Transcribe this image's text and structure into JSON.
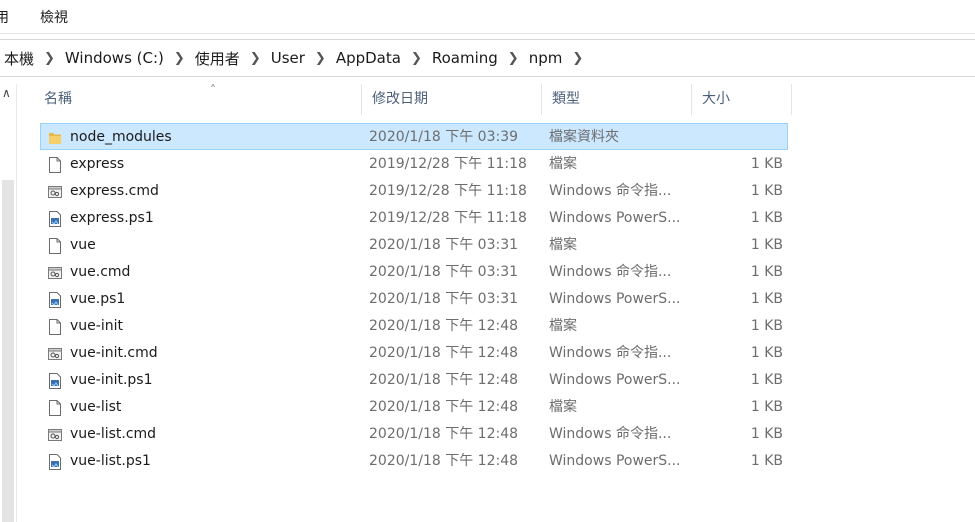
{
  "ribbon": {
    "tab_left": "用",
    "tab_view": "檢視"
  },
  "breadcrumb": [
    "本機",
    "Windows (C:)",
    "使用者",
    "User",
    "AppData",
    "Roaming",
    "npm"
  ],
  "columns": {
    "name": "名稱",
    "date": "修改日期",
    "type": "類型",
    "size": "大小"
  },
  "files": [
    {
      "name": "node_modules",
      "date": "2020/1/18 下午 03:39",
      "type": "檔案資料夾",
      "size": "",
      "icon": "folder-icon",
      "selected": true
    },
    {
      "name": "express",
      "date": "2019/12/28 下午 11:18",
      "type": "檔案",
      "size": "1 KB",
      "icon": "file-icon"
    },
    {
      "name": "express.cmd",
      "date": "2019/12/28 下午 11:18",
      "type": "Windows 命令指...",
      "size": "1 KB",
      "icon": "cmd-file-icon"
    },
    {
      "name": "express.ps1",
      "date": "2019/12/28 下午 11:18",
      "type": "Windows PowerS...",
      "size": "1 KB",
      "icon": "powershell-file-icon"
    },
    {
      "name": "vue",
      "date": "2020/1/18 下午 03:31",
      "type": "檔案",
      "size": "1 KB",
      "icon": "file-icon"
    },
    {
      "name": "vue.cmd",
      "date": "2020/1/18 下午 03:31",
      "type": "Windows 命令指...",
      "size": "1 KB",
      "icon": "cmd-file-icon"
    },
    {
      "name": "vue.ps1",
      "date": "2020/1/18 下午 03:31",
      "type": "Windows PowerS...",
      "size": "1 KB",
      "icon": "powershell-file-icon"
    },
    {
      "name": "vue-init",
      "date": "2020/1/18 下午 12:48",
      "type": "檔案",
      "size": "1 KB",
      "icon": "file-icon"
    },
    {
      "name": "vue-init.cmd",
      "date": "2020/1/18 下午 12:48",
      "type": "Windows 命令指...",
      "size": "1 KB",
      "icon": "cmd-file-icon"
    },
    {
      "name": "vue-init.ps1",
      "date": "2020/1/18 下午 12:48",
      "type": "Windows PowerS...",
      "size": "1 KB",
      "icon": "powershell-file-icon"
    },
    {
      "name": "vue-list",
      "date": "2020/1/18 下午 12:48",
      "type": "檔案",
      "size": "1 KB",
      "icon": "file-icon"
    },
    {
      "name": "vue-list.cmd",
      "date": "2020/1/18 下午 12:48",
      "type": "Windows 命令指...",
      "size": "1 KB",
      "icon": "cmd-file-icon"
    },
    {
      "name": "vue-list.ps1",
      "date": "2020/1/18 下午 12:48",
      "type": "Windows PowerS...",
      "size": "1 KB",
      "icon": "powershell-file-icon"
    }
  ],
  "colors": {
    "selection_bg": "#cce8ff",
    "selection_border": "#99d1ff",
    "header_text": "#4c607a",
    "folder": "#e8b74a"
  }
}
